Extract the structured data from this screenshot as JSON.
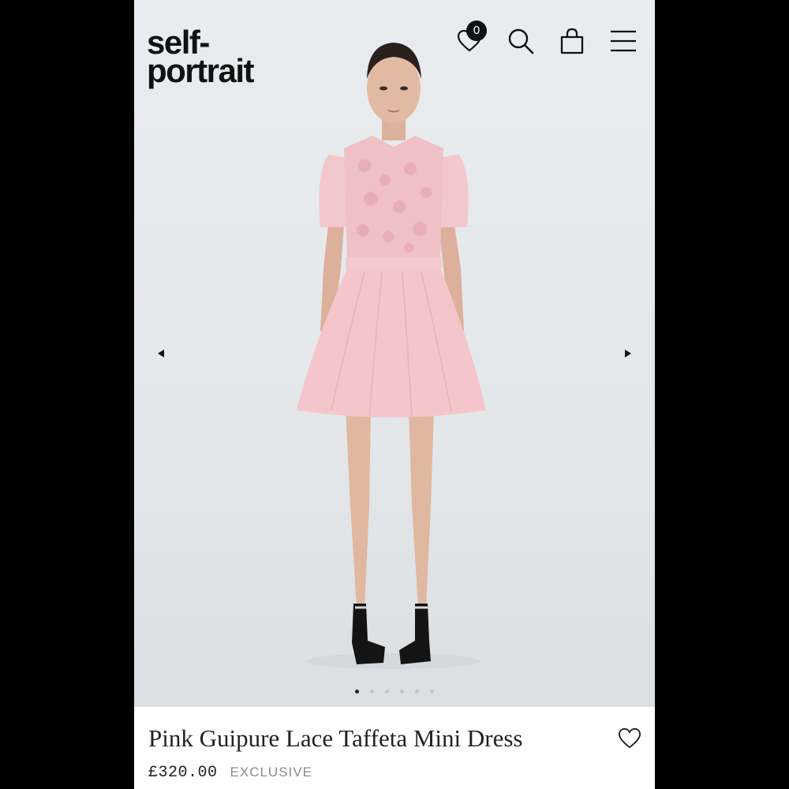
{
  "brand": {
    "logo_line1": "self-",
    "logo_line2": "portrait"
  },
  "header": {
    "wishlist_count": "0",
    "icons": [
      "heart-icon",
      "search-icon",
      "shopping-bag-icon",
      "menu-icon"
    ]
  },
  "carousel": {
    "image": "product-photo",
    "slide_count": 6,
    "active_slide": 1,
    "prev_icon": "caret-left-icon",
    "next_icon": "caret-right-icon"
  },
  "product": {
    "title": "Pink Guipure Lace Taffeta Mini Dress",
    "price": "£320.00",
    "tag": "EXCLUSIVE",
    "wishlist_icon": "heart-outline-icon"
  },
  "colors": {
    "background_frame": "#000000",
    "hero_bg": "#e6e9ec",
    "dress_pink": "#f0c4c9",
    "text_dark": "#222222",
    "tag_grey": "#8a8a8a"
  }
}
